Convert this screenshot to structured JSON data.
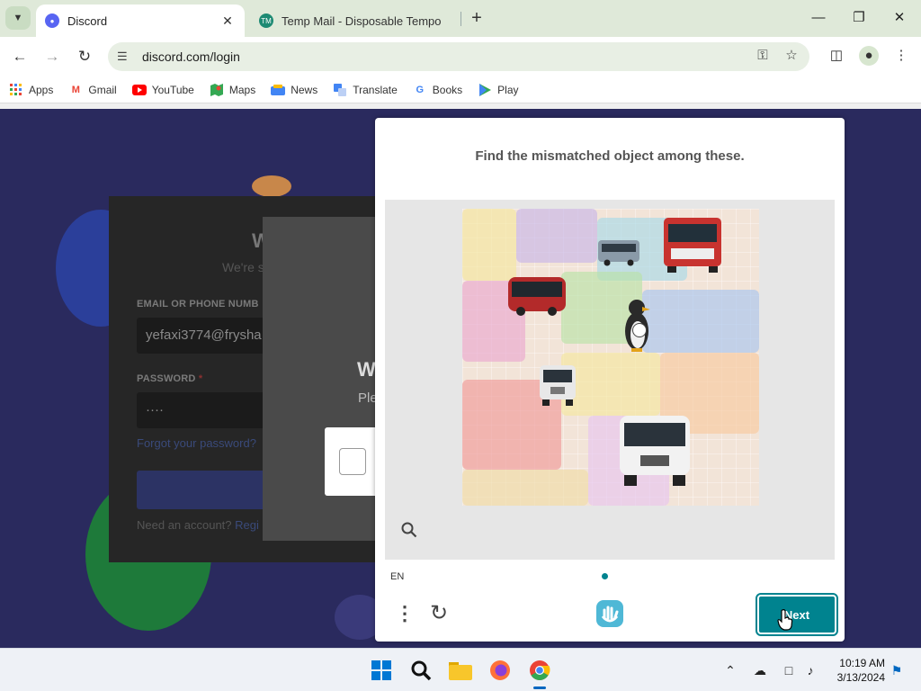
{
  "browser": {
    "tabs": [
      {
        "title": "Discord",
        "active": true
      },
      {
        "title": "Temp Mail - Disposable Tempo",
        "active": false
      }
    ],
    "url": "discord.com/login",
    "bookmarks": [
      {
        "label": "Apps",
        "icon": "apps-grid-icon"
      },
      {
        "label": "Gmail",
        "icon": "gmail-icon"
      },
      {
        "label": "YouTube",
        "icon": "youtube-icon"
      },
      {
        "label": "Maps",
        "icon": "maps-icon"
      },
      {
        "label": "News",
        "icon": "news-icon"
      },
      {
        "label": "Translate",
        "icon": "translate-icon"
      },
      {
        "label": "Books",
        "icon": "google-icon"
      },
      {
        "label": "Play",
        "icon": "play-store-icon"
      }
    ]
  },
  "login": {
    "title_fragment": "W",
    "subtitle_fragment": "We're s",
    "email_label": "EMAIL OR PHONE NUMB",
    "email_value": "yefaxi3774@frysha",
    "password_label": "PASSWORD",
    "password_required": "*",
    "password_value": "····",
    "forgot_link": "Forgot your password?",
    "footer_text": "Need an account? ",
    "footer_link": "Regi"
  },
  "verify_panel": {
    "title_fragment": "W",
    "subtitle_fragment": "Ple"
  },
  "captcha": {
    "prompt": "Find the mismatched object among these.",
    "language": "EN",
    "next_label": "Next",
    "objects": [
      "bus",
      "bus",
      "bus",
      "penguin",
      "bus",
      "bus"
    ]
  },
  "taskbar": {
    "time": "10:19 AM",
    "date": "3/13/2024"
  },
  "colors": {
    "page_bg": "#2a2a5e",
    "captcha_accent": "#00838f",
    "chrome_tabbar": "#dfe9d9"
  }
}
